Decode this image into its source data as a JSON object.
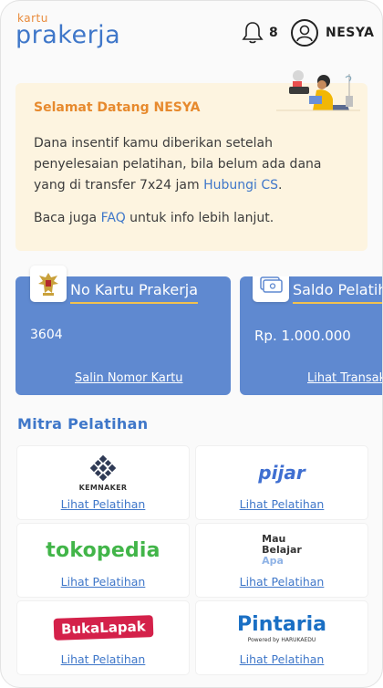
{
  "header": {
    "logo_small": "kartu",
    "logo_big": "prakerja",
    "notification_count": "8",
    "user_name": "NESYA"
  },
  "welcome": {
    "title": "Selamat Datang NESYA",
    "text_part1": "Dana insentif kamu diberikan setelah penyelesaian pelatihan, bila belum ada dana yang di transfer 7x24 jam ",
    "text_link": "Hubungi CS",
    "text_part2": ".",
    "text2_part1": "Baca juga ",
    "text2_link": "FAQ",
    "text2_part2": " untuk info lebih lanjut."
  },
  "cards": [
    {
      "title": "No Kartu Prakerja",
      "value": "3604",
      "link": "Salin Nomor Kartu",
      "icon": "garuda-emblem-icon"
    },
    {
      "title": "Saldo Pelatihan",
      "value": "Rp. 1.000.000",
      "link": "Lihat Transaksi",
      "icon": "money-icon"
    }
  ],
  "mitra": {
    "title": "Mitra Pelatihan",
    "partners": [
      {
        "name": "KEMNAKER",
        "link": "Lihat Pelatihan"
      },
      {
        "name": "pijar",
        "link": "Lihat Pelatihan"
      },
      {
        "name": "tokopedia",
        "link": "Lihat Pelatihan"
      },
      {
        "name_line1": "Mau",
        "name_line2": "Belajar",
        "name_line3": "Apa",
        "link": "Lihat Pelatihan"
      },
      {
        "name": "BukaLapak",
        "link": "Lihat Pelatihan"
      },
      {
        "name": "Pintaria",
        "powered": "Powered by HARUKAEDU",
        "link": "Lihat Pelatihan"
      }
    ]
  },
  "colors": {
    "brand_blue": "#3f77c9",
    "card_blue": "#5f89d0",
    "welcome_bg": "#fdf4e0",
    "accent_orange": "#e78a2e"
  }
}
